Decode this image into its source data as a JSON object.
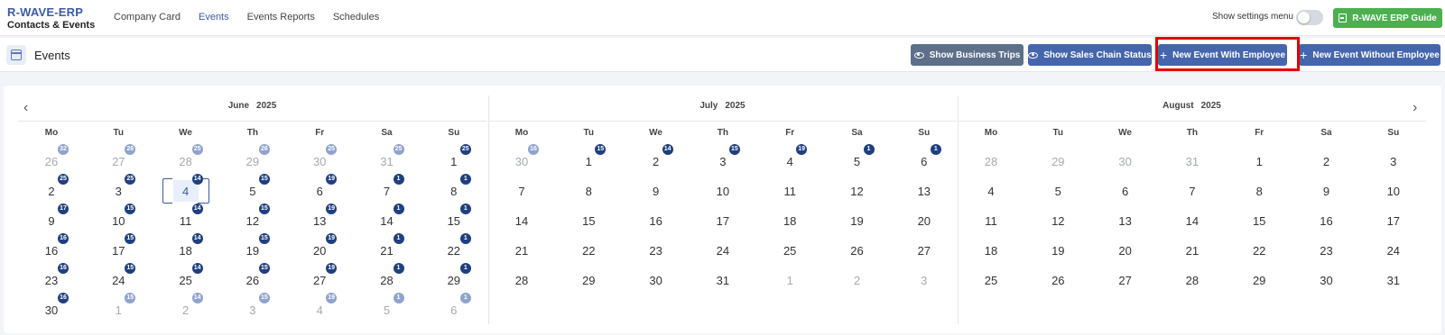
{
  "app": {
    "title": "R-WAVE-ERP",
    "subtitle": "Contacts & Events"
  },
  "nav": [
    {
      "label": "Company Card",
      "active": false
    },
    {
      "label": "Events",
      "active": true
    },
    {
      "label": "Events Reports",
      "active": false
    },
    {
      "label": "Schedules",
      "active": false
    }
  ],
  "settings": {
    "label": "Show settings menu",
    "toggle_on": false
  },
  "guide_button": {
    "label": "R-WAVE ERP Guide",
    "icon": "book-icon",
    "color": "#4caf50"
  },
  "page": {
    "title": "Events",
    "icon": "calendar-icon"
  },
  "actions": {
    "show_business_trips": "Show Business Trips",
    "show_sales_chain": "Show Sales Chain Status",
    "new_event_with_employee": "New Event With Employee",
    "new_event_without_employee": "New Event Without Employee"
  },
  "colors": {
    "primary": "#4565ad",
    "secondary": "#5d6f89",
    "highlight": "#e30000",
    "badge": "#1f3f7f"
  },
  "weekdays": [
    "Mo",
    "Tu",
    "We",
    "Th",
    "Fr",
    "Sa",
    "Su"
  ],
  "months": [
    {
      "name": "June",
      "year": "2025",
      "weeks": [
        [
          {
            "d": "26",
            "o": true,
            "b": "32"
          },
          {
            "d": "27",
            "o": true,
            "b": "26"
          },
          {
            "d": "28",
            "o": true,
            "b": "25"
          },
          {
            "d": "29",
            "o": true,
            "b": "26"
          },
          {
            "d": "30",
            "o": true,
            "b": "25"
          },
          {
            "d": "31",
            "o": true,
            "b": "25"
          },
          {
            "d": "1",
            "b": "25"
          }
        ],
        [
          {
            "d": "2",
            "b": "25"
          },
          {
            "d": "3",
            "b": "25"
          },
          {
            "d": "4",
            "b": "14",
            "sel": true
          },
          {
            "d": "5",
            "b": "15"
          },
          {
            "d": "6",
            "b": "19"
          },
          {
            "d": "7",
            "b": "1"
          },
          {
            "d": "8",
            "b": "1"
          }
        ],
        [
          {
            "d": "9",
            "b": "17"
          },
          {
            "d": "10",
            "b": "15"
          },
          {
            "d": "11",
            "b": "14"
          },
          {
            "d": "12",
            "b": "15"
          },
          {
            "d": "13",
            "b": "19"
          },
          {
            "d": "14",
            "b": "1"
          },
          {
            "d": "15",
            "b": "1"
          }
        ],
        [
          {
            "d": "16",
            "b": "16"
          },
          {
            "d": "17",
            "b": "15"
          },
          {
            "d": "18",
            "b": "14"
          },
          {
            "d": "19",
            "b": "15"
          },
          {
            "d": "20",
            "b": "19"
          },
          {
            "d": "21",
            "b": "1"
          },
          {
            "d": "22",
            "b": "1"
          }
        ],
        [
          {
            "d": "23",
            "b": "16"
          },
          {
            "d": "24",
            "b": "15"
          },
          {
            "d": "25",
            "b": "14"
          },
          {
            "d": "26",
            "b": "15"
          },
          {
            "d": "27",
            "b": "19"
          },
          {
            "d": "28",
            "b": "1"
          },
          {
            "d": "29",
            "b": "1"
          }
        ],
        [
          {
            "d": "30",
            "b": "16"
          },
          {
            "d": "1",
            "o": true,
            "b": "15"
          },
          {
            "d": "2",
            "o": true,
            "b": "14"
          },
          {
            "d": "3",
            "o": true,
            "b": "15"
          },
          {
            "d": "4",
            "o": true,
            "b": "19"
          },
          {
            "d": "5",
            "o": true,
            "b": "1"
          },
          {
            "d": "6",
            "o": true,
            "b": "1"
          }
        ]
      ]
    },
    {
      "name": "July",
      "year": "2025",
      "weeks": [
        [
          {
            "d": "30",
            "o": true,
            "b": "16"
          },
          {
            "d": "1",
            "b": "15"
          },
          {
            "d": "2",
            "b": "14"
          },
          {
            "d": "3",
            "b": "15"
          },
          {
            "d": "4",
            "b": "19"
          },
          {
            "d": "5",
            "b": "1"
          },
          {
            "d": "6",
            "b": "1"
          }
        ],
        [
          {
            "d": "7"
          },
          {
            "d": "8"
          },
          {
            "d": "9"
          },
          {
            "d": "10"
          },
          {
            "d": "11"
          },
          {
            "d": "12"
          },
          {
            "d": "13"
          }
        ],
        [
          {
            "d": "14"
          },
          {
            "d": "15"
          },
          {
            "d": "16"
          },
          {
            "d": "17"
          },
          {
            "d": "18"
          },
          {
            "d": "19"
          },
          {
            "d": "20"
          }
        ],
        [
          {
            "d": "21"
          },
          {
            "d": "22"
          },
          {
            "d": "23"
          },
          {
            "d": "24"
          },
          {
            "d": "25"
          },
          {
            "d": "26"
          },
          {
            "d": "27"
          }
        ],
        [
          {
            "d": "28"
          },
          {
            "d": "29"
          },
          {
            "d": "30"
          },
          {
            "d": "31"
          },
          {
            "d": "1",
            "o": true
          },
          {
            "d": "2",
            "o": true
          },
          {
            "d": "3",
            "o": true
          }
        ]
      ]
    },
    {
      "name": "August",
      "year": "2025",
      "weeks": [
        [
          {
            "d": "28",
            "o": true
          },
          {
            "d": "29",
            "o": true
          },
          {
            "d": "30",
            "o": true
          },
          {
            "d": "31",
            "o": true
          },
          {
            "d": "1"
          },
          {
            "d": "2"
          },
          {
            "d": "3"
          }
        ],
        [
          {
            "d": "4"
          },
          {
            "d": "5"
          },
          {
            "d": "6"
          },
          {
            "d": "7"
          },
          {
            "d": "8"
          },
          {
            "d": "9"
          },
          {
            "d": "10"
          }
        ],
        [
          {
            "d": "11"
          },
          {
            "d": "12"
          },
          {
            "d": "13"
          },
          {
            "d": "14"
          },
          {
            "d": "15"
          },
          {
            "d": "16"
          },
          {
            "d": "17"
          }
        ],
        [
          {
            "d": "18"
          },
          {
            "d": "19"
          },
          {
            "d": "20"
          },
          {
            "d": "21"
          },
          {
            "d": "22"
          },
          {
            "d": "23"
          },
          {
            "d": "24"
          }
        ],
        [
          {
            "d": "25"
          },
          {
            "d": "26"
          },
          {
            "d": "27"
          },
          {
            "d": "28"
          },
          {
            "d": "29"
          },
          {
            "d": "30"
          },
          {
            "d": "31"
          }
        ]
      ]
    }
  ]
}
